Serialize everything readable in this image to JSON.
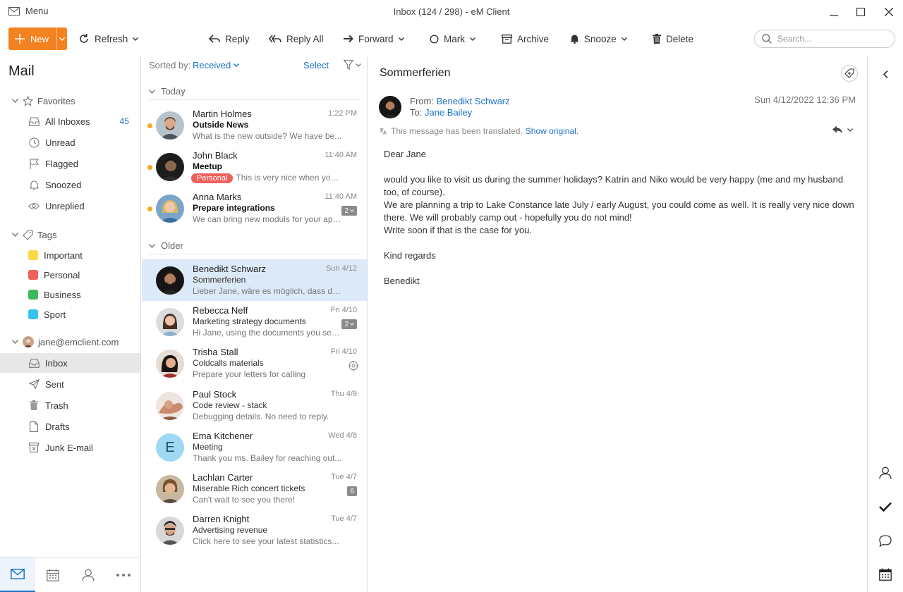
{
  "titlebar": {
    "menu_label": "Menu",
    "window_title": "Inbox (124 / 298) - eM Client"
  },
  "toolbar": {
    "new_label": "New",
    "refresh_label": "Refresh",
    "reply_label": "Reply",
    "reply_all_label": "Reply All",
    "forward_label": "Forward",
    "mark_label": "Mark",
    "archive_label": "Archive",
    "snooze_label": "Snooze",
    "delete_label": "Delete",
    "search_placeholder": "Search..."
  },
  "colors": {
    "accent": "#f58220",
    "link": "#1a73c8",
    "selected_row": "#dce9f8",
    "unread_dot": "#f5a623"
  },
  "sidebar": {
    "heading": "Mail",
    "favorites_label": "Favorites",
    "favorites": [
      {
        "label": "All Inboxes",
        "count": "45",
        "icon": "inbox-icon"
      },
      {
        "label": "Unread",
        "icon": "clock-icon"
      },
      {
        "label": "Flagged",
        "icon": "flag-icon"
      },
      {
        "label": "Snoozed",
        "icon": "bell-icon"
      },
      {
        "label": "Unreplied",
        "icon": "eye-icon"
      }
    ],
    "tags_label": "Tags",
    "tags": [
      {
        "label": "Important",
        "color": "#f9d84a"
      },
      {
        "label": "Personal",
        "color": "#f0605a"
      },
      {
        "label": "Business",
        "color": "#3cb95a"
      },
      {
        "label": "Sport",
        "color": "#36c3f2"
      }
    ],
    "account_label": "jane@emclient.com",
    "folders": [
      {
        "label": "Inbox",
        "icon": "inbox-icon"
      },
      {
        "label": "Sent",
        "icon": "send-icon"
      },
      {
        "label": "Trash",
        "icon": "trash-icon"
      },
      {
        "label": "Drafts",
        "icon": "document-icon"
      },
      {
        "label": "Junk E-mail",
        "icon": "junk-icon"
      }
    ]
  },
  "message_list": {
    "sorted_by_label": "Sorted by:",
    "sorted_by_value": "Received",
    "select_label": "Select",
    "group_today": "Today",
    "group_older": "Older",
    "messages": [
      {
        "sender": "Martin Holmes",
        "date": "1:22 PM",
        "subject": "Outside News",
        "preview": "What is the new outside? We have be...",
        "unread": true
      },
      {
        "sender": "John Black",
        "date": "11:40 AM",
        "subject": "Meetup",
        "tag": "Personal",
        "preview": "This is very nice when you...",
        "unread": true
      },
      {
        "sender": "Anna Marks",
        "date": "11:40 AM",
        "subject": "Prepare integrations",
        "preview": "We can bring new moduls for your app...",
        "badge": "2",
        "unread": true
      },
      {
        "sender": "Benedikt Schwarz",
        "date": "Sun 4/12",
        "subject": "Sommerferien",
        "preview": "Lieber Jane, wäre es möglich,  dass du...",
        "selected": true
      },
      {
        "sender": "Rebecca Neff",
        "date": "Fri 4/10",
        "subject": "Marketing strategy documents",
        "preview": "Hi Jane, using the documents you sent...",
        "badge": "2"
      },
      {
        "sender": "Trisha Stall",
        "date": "Fri 4/10",
        "subject": "Coldcalls materials",
        "preview": "Prepare your letters for calling"
      },
      {
        "sender": "Paul Stock",
        "date": "Thu 4/9",
        "subject": "Code review - stack",
        "preview": "Debugging details. No need to reply."
      },
      {
        "sender": "Ema Kitchener",
        "date": "Wed 4/8",
        "subject": "Meeting",
        "preview": "Thank you ms. Bailey for reaching out...",
        "initial": "E"
      },
      {
        "sender": "Lachlan Carter",
        "date": "Tue 4/7",
        "subject": "Miserable Rich concert tickets",
        "preview": "Can't wait to see you there!",
        "badge": "6"
      },
      {
        "sender": "Darren Knight",
        "date": "Tue 4/7",
        "subject": "Advertising revenue",
        "preview": "Click here to see your latest statistics..."
      }
    ]
  },
  "reader": {
    "subject": "Sommerferien",
    "from_label": "From:",
    "from": "Benedikt Schwarz",
    "to_label": "To:",
    "to": "Jane Bailey",
    "date": "Sun 4/12/2022 12:36 PM",
    "translated_note": "This message has been translated.",
    "show_original": "Show original.",
    "body": [
      "Dear Jane",
      "",
      "would you like to visit us during the summer holidays? Katrin and Niko would be very happy (me and my husband too, of course).",
      "We are planning a trip to Lake Constance late July / early August, you could come as well. It is really very nice down there.  We will probably camp out - hopefully you do not mind!",
      "Write soon if that is the case for you.",
      "",
      "Kind regards",
      "",
      "Benedikt"
    ]
  }
}
